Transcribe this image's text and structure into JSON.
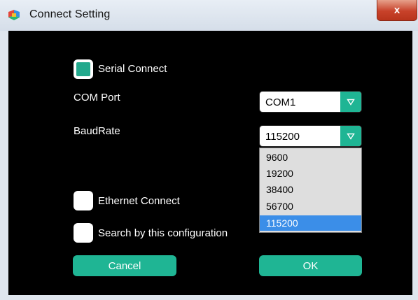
{
  "window": {
    "title": "Connect Setting",
    "close_glyph": "x"
  },
  "serial": {
    "checkbox_label": "Serial Connect",
    "checked": true
  },
  "com_port": {
    "label": "COM Port",
    "value": "COM1"
  },
  "baud_rate": {
    "label": "BaudRate",
    "value": "115200",
    "options": [
      "9600",
      "19200",
      "38400",
      "56700",
      "115200"
    ],
    "selected_index": 4
  },
  "ethernet": {
    "checkbox_label": "Ethernet Connect",
    "checked": false
  },
  "search": {
    "checkbox_label": "Search by this configuration",
    "checked": false
  },
  "buttons": {
    "cancel": "Cancel",
    "ok": "OK"
  },
  "colors": {
    "accent": "#1fb594",
    "background": "#000000",
    "selection": "#3b8ee8"
  },
  "icons": {
    "app": "app-logo-icon",
    "dropdown": "triangle-down-icon",
    "close": "close-icon"
  }
}
